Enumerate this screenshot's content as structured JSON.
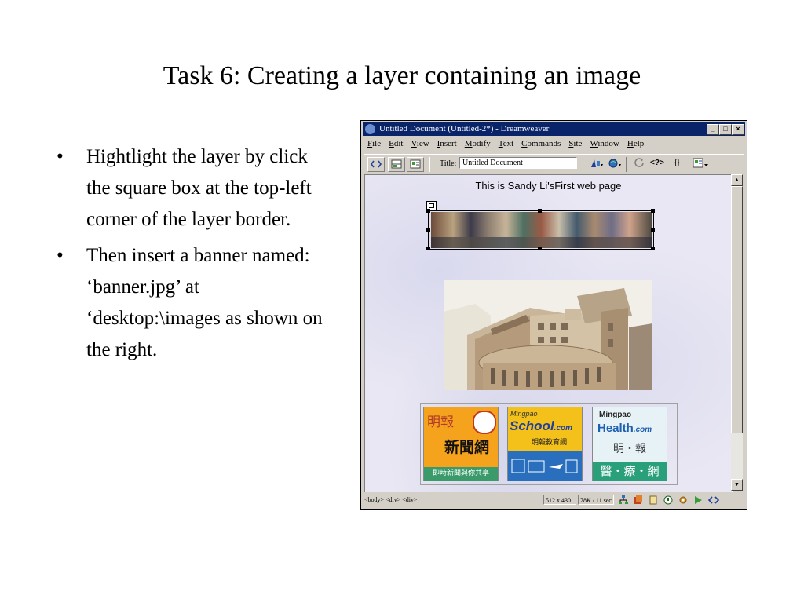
{
  "slide": {
    "title": "Task 6: Creating a layer containing an image",
    "bullets": [
      "Hightlight the layer by click the square box at the top-left corner of the layer border.",
      "Then insert a banner named: ‘banner.jpg’ at ‘desktop:\\images as shown on the right."
    ],
    "bullet_glyph": "•"
  },
  "window": {
    "title": "Untitled Document (Untitled-2*) - Dreamweaver",
    "controls": [
      "_",
      "□",
      "×"
    ],
    "menu": [
      "File",
      "Edit",
      "View",
      "Insert",
      "Modify",
      "Text",
      "Commands",
      "Site",
      "Window",
      "Help"
    ],
    "toolbar": {
      "title_label": "Title:",
      "title_value": "Untitled Document",
      "icons": [
        "code-view-icon",
        "split-view-icon",
        "design-view-icon",
        "file-management-icon",
        "preview-icon",
        "refresh-icon",
        "reference-icon",
        "code-navigation-icon",
        "view-options-icon"
      ],
      "reference_label": "<?>",
      "braces_label": "{}"
    },
    "document": {
      "heading": "This is Sandy Li'sFirst web page",
      "ads": [
        {
          "line1": "明報",
          "line2": "新聞網",
          "line3": "即時新聞與你共享"
        },
        {
          "line1": "Mingpao",
          "line2": "School",
          "line2b": ".com",
          "line3": "明報教育網"
        },
        {
          "line1": "Mingpao",
          "line2": "Health",
          "line2b": ".com",
          "line3": "明・報",
          "line4": "醫・療・網"
        }
      ]
    },
    "statusbar": {
      "tags": "<body> <div> <div>",
      "window_size": "512 x 430",
      "download": "78K / 11 sec"
    }
  }
}
